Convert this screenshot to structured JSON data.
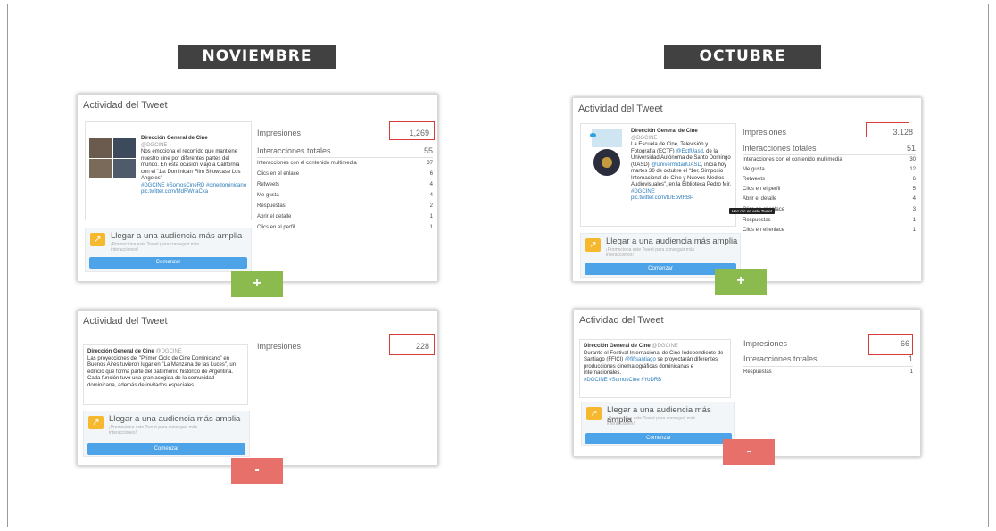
{
  "headers": {
    "left": "NOVIEMBRE",
    "right": "OCTUBRE"
  },
  "colors": {
    "highlight": "#d93a3a",
    "plus": "#8bbb4e",
    "minus": "#e8706a",
    "cta": "#4da3e8",
    "header_bg": "#414141"
  },
  "nov_top": {
    "title": "Actividad del Tweet",
    "tweet": {
      "author": "Dirección General de Cine",
      "handle": "@DGCINE",
      "text": "Nos emociona el recorrido que mantiene nuestro cine por diferentes partes del mundo. En esta ocasión viajó a California con el \"1st Dominican Film Showcase Los Angeles\"",
      "tags": "#DGCINE #SomosCineRD #cinedominicano",
      "link": "pic.twitter.com/MdRWrlaCxa"
    },
    "impressions_label": "Impresiones",
    "impressions_value": "1,269",
    "engagements_label": "Interacciones totales",
    "engagements_value": "55",
    "rows": [
      {
        "label": "Interacciones con el contenido multimedia",
        "value": "37"
      },
      {
        "label": "Clics en el enlace",
        "value": "6"
      },
      {
        "label": "Retweets",
        "value": "4"
      },
      {
        "label": "Me gusta",
        "value": "4"
      },
      {
        "label": "Respuestas",
        "value": "2"
      },
      {
        "label": "Abrir el detalle",
        "value": "1"
      },
      {
        "label": "Clics en el perfil",
        "value": "1"
      }
    ],
    "promo_title": "Llegar a una audiencia más amplia",
    "promo_sub": "¡Promociona este Tweet para conseguir más interacciones!",
    "cta": "Comenzar",
    "toggle": "+"
  },
  "nov_bottom": {
    "title": "Actividad del Tweet",
    "tweet": {
      "author": "Dirección General de Cine",
      "handle": "@DGCINE",
      "text": "Las proyecciones del \"Primer Ciclo de Cine Dominicano\" en Buenos Aires tuvieron lugar en \"La Manzana de las Luces\", un edificio que forma parte del patrimonio histórico de Argentina. Cada función tuvo una gran acogida de la comunidad dominicana, además de invitados especiales."
    },
    "impressions_label": "Impresiones",
    "impressions_value": "228",
    "promo_title": "Llegar a una audiencia más amplia",
    "promo_sub": "¡Promociona este Tweet para conseguir más interacciones!",
    "cta": "Comenzar",
    "toggle": "-"
  },
  "oct_top": {
    "title": "Actividad del Tweet",
    "tweet": {
      "author": "Dirección General de Cine",
      "handle": "@DGCINE",
      "text1": "La Escuela de Cine, Televisión y Fotografía (ECTF)",
      "mention1": "@EctfUasd",
      "text2": ", de la Universidad Autónoma de Santo Domingo (UASD)",
      "mention2": "@UnivermidadUASD",
      "text3": ", inicia hoy martes 30 de octubre el \"1er. Simposio Internacional de Cine y Nuevos Medios Audiovisuales\", en la Biblioteca Pedro Mir.",
      "tags": "#DGCINE",
      "link": "pic.twitter.com/tUEbvtRBP"
    },
    "impressions_label": "Impresiones",
    "impressions_value": "3.128",
    "engagements_label": "Interacciones totales",
    "engagements_value": "51",
    "rows": [
      {
        "label": "Interacciones con el contenido multimedia",
        "value": "30"
      },
      {
        "label": "Me gusta",
        "value": "12"
      },
      {
        "label": "Retweets",
        "value": "6"
      },
      {
        "label": "Clics en el perfil",
        "value": "5"
      },
      {
        "label": "Abrir el detalle",
        "value": "4"
      },
      {
        "label": "Clics en el enlace",
        "value": "3"
      },
      {
        "label": "Respuestas",
        "value": "1"
      },
      {
        "label": "Clics en el enlace",
        "value": "1"
      }
    ],
    "tooltip": "Haz clic en este Tweet",
    "promo_title": "Llegar a una audiencia más amplia",
    "promo_sub": "¡Promociona este Tweet para conseguir más interacciones!",
    "cta": "Comenzar",
    "toggle": "+"
  },
  "oct_bottom": {
    "title": "Actividad del Tweet",
    "tweet": {
      "author": "Dirección General de Cine",
      "handle": "@DGCINE",
      "text1": "Durante el Festival Internacional de Cine Independiente de Santiago (FFICI)",
      "mention": "@fifisantiago",
      "text2": " se proyectarán diferentes producciones cinematográficas dominicanas e internacionales.",
      "tags": "#DGCINE #SomosCine #YoDRB"
    },
    "impressions_label": "Impresiones",
    "impressions_value": "66",
    "engagements_label": "Interacciones totales",
    "engagements_value": "1",
    "rows": [
      {
        "label": "Respuestas",
        "value": "1"
      }
    ],
    "promo_title": "Llegar a una audiencia más amplia",
    "promo_sub": "¡Promociona este Tweet para conseguir más interacciones!",
    "cta": "Comenzar",
    "toggle": "-"
  }
}
